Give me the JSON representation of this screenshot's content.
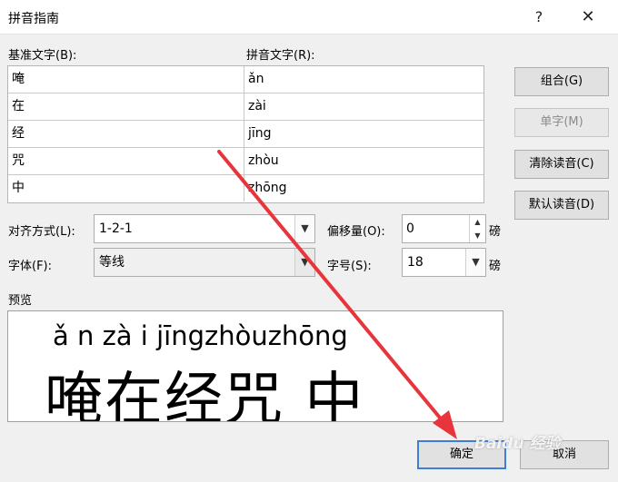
{
  "dialog": {
    "title": "拼音指南",
    "help_glyph": "?",
    "close_glyph": "✕"
  },
  "labels": {
    "base_text": "基准文字(B):",
    "pinyin_text": "拼音文字(R):",
    "alignment": "对齐方式(L):",
    "offset": "偏移量(O):",
    "font": "字体(F):",
    "size": "字号(S):",
    "preview": "预览",
    "unit_pt": "磅"
  },
  "rows": [
    {
      "base": "唵",
      "pinyin": "ǎn"
    },
    {
      "base": "在",
      "pinyin": "zài"
    },
    {
      "base": "经",
      "pinyin": "jīng"
    },
    {
      "base": "咒",
      "pinyin": "zhòu"
    },
    {
      "base": "中",
      "pinyin": "zhōng"
    }
  ],
  "buttons": {
    "group": "组合(G)",
    "single": "单字(M)",
    "clear": "清除读音(C)",
    "default_reading": "默认读音(D)",
    "ok": "确定",
    "cancel": "取消"
  },
  "fields": {
    "alignment": "1-2-1",
    "offset": "0",
    "font": "等线",
    "size": "18"
  },
  "preview": {
    "pinyin_line": "ǎ n zà i jīngzhòuzhōng",
    "base_line": "唵在经咒 中"
  },
  "watermark": "Baidu 经验",
  "colors": {
    "arrow": "#e8343b",
    "default_button_border": "#3c7fd4"
  },
  "icons": {
    "dropdown": "chevron-down-icon",
    "spin_up": "spin-up-icon",
    "spin_down": "spin-down-icon"
  }
}
